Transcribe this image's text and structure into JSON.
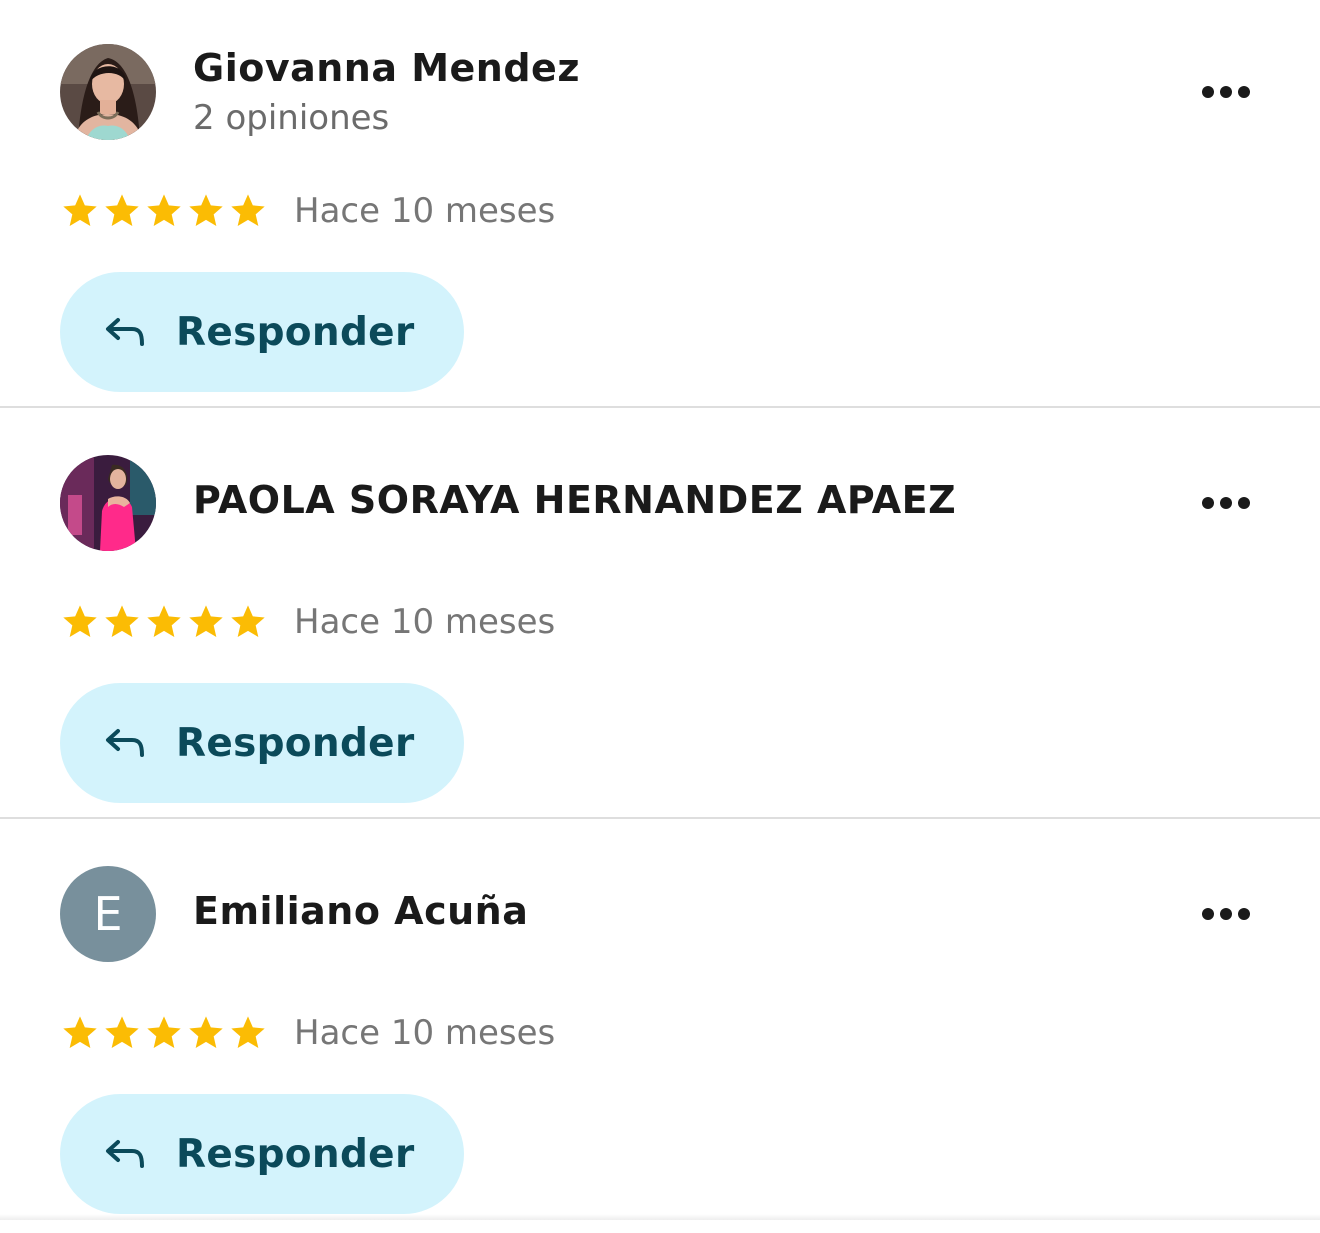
{
  "reviews": [
    {
      "name": "Giovanna Mendez",
      "subtitle": "2 opiniones",
      "avatar": "photo-woman-teal-top",
      "rating": 5,
      "date": "Hace 10 meses",
      "reply_label": "Responder"
    },
    {
      "name": "PAOLA SORAYA HERNANDEZ APAEZ",
      "subtitle": "",
      "avatar": "photo-woman-pink-dress",
      "rating": 5,
      "date": "Hace 10 meses",
      "reply_label": "Responder"
    },
    {
      "name": "Emiliano Acuña",
      "subtitle": "",
      "avatar_letter": "E",
      "rating": 5,
      "date": "Hace 10 meses",
      "reply_label": "Responder"
    }
  ],
  "colors": {
    "star": "#fbbc04",
    "reply_background": "#d3f3fc",
    "reply_text": "#0b4a5a",
    "letter_avatar": "#78909c"
  },
  "icons": {
    "reply": "reply-arrow-icon",
    "more": "more-options-icon",
    "star": "star-icon"
  }
}
